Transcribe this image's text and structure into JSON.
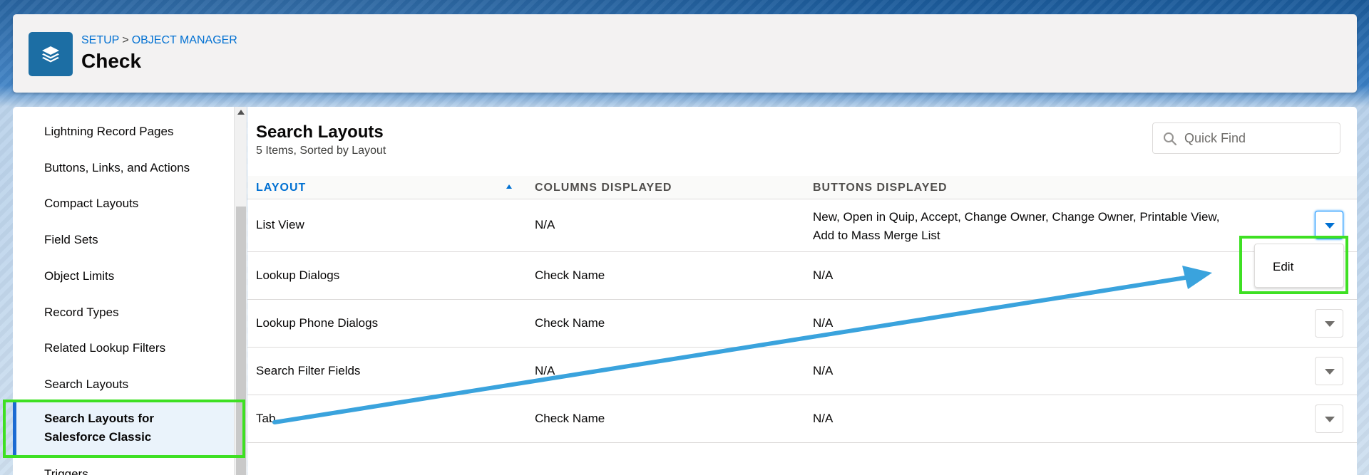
{
  "header": {
    "breadcrumb": [
      "SETUP",
      "OBJECT MANAGER"
    ],
    "breadcrumb_separator": ">",
    "title": "Check",
    "icon": "layers-icon",
    "icon_color": "#1c6ea4"
  },
  "sidebar": {
    "items": [
      {
        "label": "Lightning Record Pages"
      },
      {
        "label": "Buttons, Links, and Actions"
      },
      {
        "label": "Compact Layouts"
      },
      {
        "label": "Field Sets"
      },
      {
        "label": "Object Limits"
      },
      {
        "label": "Record Types"
      },
      {
        "label": "Related Lookup Filters"
      },
      {
        "label": "Search Layouts"
      },
      {
        "label": "Search Layouts for",
        "label2": "Salesforce Classic",
        "active": true
      },
      {
        "label": "Triggers"
      }
    ]
  },
  "main": {
    "title": "Search Layouts",
    "subtitle": "5 Items, Sorted by Layout",
    "quick_find_placeholder": "Quick Find",
    "columns": [
      "LAYOUT",
      "COLUMNS DISPLAYED",
      "BUTTONS DISPLAYED"
    ],
    "rows": [
      {
        "layout": "List View",
        "columns": "N/A",
        "buttons": "New, Open in Quip, Accept, Change Owner, Change Owner, Printable View,",
        "buttons2": "Add to Mass Merge List"
      },
      {
        "layout": "Lookup Dialogs",
        "columns": "Check Name",
        "buttons": "N/A"
      },
      {
        "layout": "Lookup Phone Dialogs",
        "columns": "Check Name",
        "buttons": "N/A"
      },
      {
        "layout": "Search Filter Fields",
        "columns": "N/A",
        "buttons": "N/A"
      },
      {
        "layout": "Tab",
        "columns": "Check Name",
        "buttons": "N/A"
      }
    ],
    "row_menu": {
      "item": "Edit"
    }
  },
  "colors": {
    "accent": "#0070d2",
    "highlight": "#3ee023",
    "annotation_arrow": "#3aa3dd"
  }
}
